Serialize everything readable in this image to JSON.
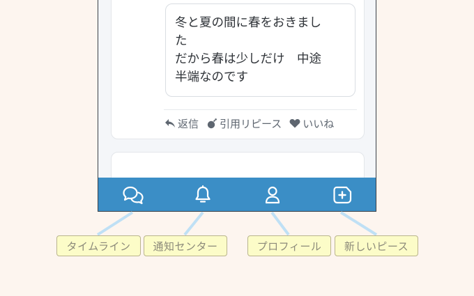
{
  "post": {
    "quote_lines": [
      "冬と夏の間に春をおきまし",
      "た",
      "だから春は少しだけ　中途",
      "半端なのです"
    ],
    "actions": {
      "reply": "返信",
      "quote_repost": "引用リピース",
      "like": "いいね"
    }
  },
  "tabbar": {
    "icons": [
      "chat-bubbles-icon",
      "bell-icon",
      "user-icon",
      "new-piece-icon"
    ]
  },
  "labels": {
    "timeline": "タイムライン",
    "notifications": "通知センター",
    "profile": "プロフィール",
    "new_piece": "新しいピース"
  },
  "colors": {
    "page_background": "#fdf5ef",
    "tabbar": "#3b8ec6",
    "label_background": "#fcfcc8",
    "label_border": "#b9b48d",
    "connector": "#bfe0f5"
  }
}
